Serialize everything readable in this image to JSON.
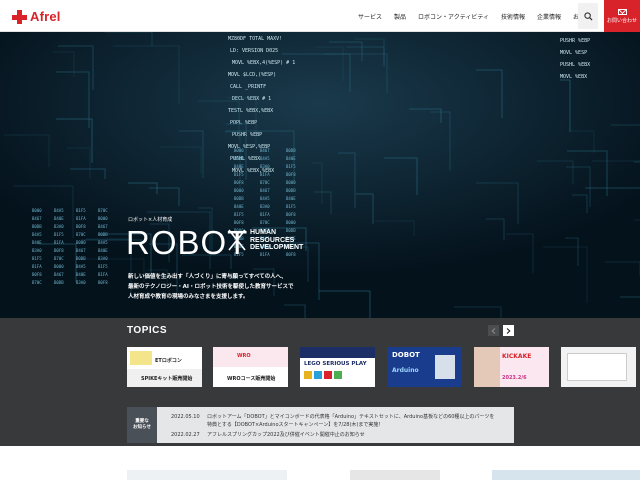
{
  "brand": {
    "logo_text": "Afrel",
    "red": "#d8232a"
  },
  "nav": {
    "items": [
      {
        "label": "サービス"
      },
      {
        "label": "製品"
      },
      {
        "label": "ロボコン・アクティビティ"
      },
      {
        "label": "技術情報"
      },
      {
        "label": "企業情報"
      },
      {
        "label": "お知らせ"
      }
    ],
    "search_icon": "search-icon",
    "contact_label": "お問い合わせ"
  },
  "hero": {
    "subtitle": "ロボット×人材育成",
    "title": "ROBOT",
    "hrd_line1": "HUMAN",
    "hrd_line2": "RESOURCES",
    "hrd_line3": "DEVELOPMENT",
    "desc_line1": "新しい価値を生み出す「人づくり」に寄与願ってすべての人へ、",
    "desc_line2": "最新のテクノロジー・AI・ロボット技術を駆使した教育サービスで",
    "desc_line3": "人材育成や教育の現場のみなさまを支援します。",
    "code_lines": [
      "MZ80DF TOTAL MAXV!",
      "LD: VERSION D025",
      "MOVL %EBX,4(%ESP) # 1",
      "MOVL $LCD,(%ESP)",
      "CALL _PRINTF",
      "DECL %EBX # 1",
      "TESTL %EBX,%EBX",
      "POPL %EBP",
      "PUSHR %EBP",
      "MOVL %ESP,%EBP",
      "PUSHL %EBX",
      "MOVL %EBX,%EBX"
    ]
  },
  "topics": {
    "title": "TOPICS",
    "prev_icon": "chevron-left-icon",
    "next_icon": "chevron-right-icon",
    "cards": [
      {
        "label_top": "ETロボコン",
        "label_bottom": "SPIKEキット販売開始"
      },
      {
        "label_top": "WRO",
        "label_bottom": "WROコース販売開始"
      },
      {
        "label_top": "LEGO SERIOUS PLAY",
        "label_bottom": ""
      },
      {
        "label_top": "DOBOT",
        "label_bottom": "Arduino"
      },
      {
        "label_top": "KICKAKE",
        "label_bottom": "2023.2/6"
      },
      {
        "label_top": "",
        "label_bottom": ""
      }
    ]
  },
  "news": {
    "tag_line1": "重要な",
    "tag_line2": "お知らせ",
    "items": [
      {
        "date": "2022.05.10",
        "text": "ロボットアーム「DOBOT」とマイコンボードの代表格「Arduino」テキストセットに、Arduino基板などの60種以上のパーツを"
      },
      {
        "date": "",
        "text": "特典とする【DOBOT×Arduinoスタートキャンペーン】を7/28(木)まで実施！"
      },
      {
        "date": "2022.02.27",
        "text": "アフレルスプリングカップ2022及び併催イベント開催中止のお知らせ"
      }
    ]
  }
}
